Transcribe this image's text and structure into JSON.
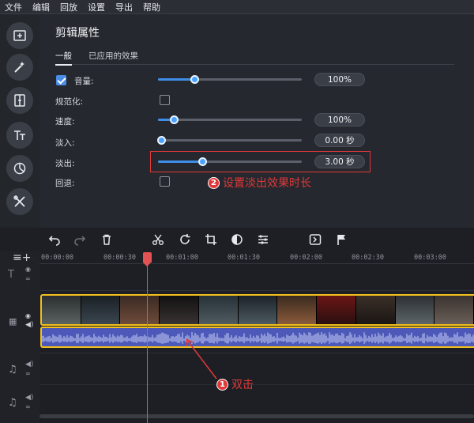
{
  "menu": [
    "文件",
    "编辑",
    "回放",
    "设置",
    "导出",
    "帮助"
  ],
  "rail_icons": [
    "add-media-icon",
    "magic-wand-icon",
    "transitions-icon",
    "titles-icon",
    "filters-icon",
    "tools-icon"
  ],
  "panel": {
    "title": "剪辑属性",
    "tabs": [
      {
        "label": "一般",
        "active": true
      },
      {
        "label": "已应用的效果",
        "active": false
      }
    ],
    "rows": {
      "volume": {
        "label": "音量:",
        "checked": true,
        "level": 0.25,
        "value": "100%"
      },
      "normalize": {
        "label": "规范化:",
        "checked": false
      },
      "speed": {
        "label": "速度:",
        "level": 0.11,
        "value": "100%"
      },
      "fade_in": {
        "label": "淡入:",
        "level": 0.02,
        "value": "0.00 秒"
      },
      "fade_out": {
        "label": "淡出:",
        "level": 0.31,
        "value": "3.00 秒"
      },
      "reverse": {
        "label": "回退:",
        "checked": false
      }
    }
  },
  "annotations": {
    "step2": {
      "number": "2",
      "text": "设置淡出效果时长"
    },
    "step1": {
      "number": "1",
      "text": "双击"
    },
    "accent": "#e0393a"
  },
  "timeline": {
    "toolbar_icons": [
      "undo-icon",
      "redo-icon",
      "delete-icon",
      "cut-icon",
      "rotate-icon",
      "crop-icon",
      "color-adjust-icon",
      "equalizer-icon",
      "clip-properties-icon",
      "flag-icon"
    ],
    "ruler": [
      "00:00:00",
      "00:00:30",
      "00:01:00",
      "00:01:30",
      "00:02:00",
      "00:02:30",
      "00:03:00"
    ],
    "playhead_time_fraction": 0.39,
    "clip_border_color": "#f2c01d",
    "audio_color": "#4c59b8"
  }
}
